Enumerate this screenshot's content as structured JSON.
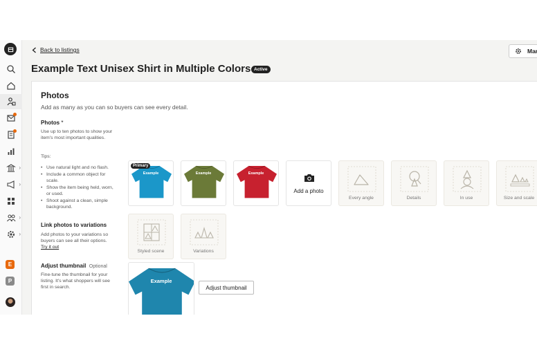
{
  "nav": {
    "back_label": "Back to listings",
    "manage_label": "Mar"
  },
  "listing": {
    "title": "Example Text Unisex Shirt in Multiple Colors",
    "status": "Active"
  },
  "rail": {
    "shop_badges": [
      {
        "letter": "E",
        "color": "#e8690d"
      },
      {
        "letter": "P",
        "color": "#8a8a8a"
      }
    ]
  },
  "photos": {
    "section_title": "Photos",
    "section_subtitle": "Add as many as you can so buyers can see every detail.",
    "side_heading": "Photos",
    "required_mark": "*",
    "side_text": "Use up to ten photos to show your item's most important qualities.",
    "tips_label": "Tips:",
    "tips": [
      "Use natural light and no flash.",
      "Include a common object for scale.",
      "Show the item being held, worn, or used.",
      "Shoot against a clean, simple background."
    ],
    "uploaded": [
      {
        "label": "Example",
        "color": "#1b97c9",
        "primary": true
      },
      {
        "label": "Example",
        "color": "#6b7a38",
        "primary": false
      },
      {
        "label": "Example",
        "color": "#c7212f",
        "primary": false
      }
    ],
    "primary_label": "Primary",
    "add_label": "Add a photo",
    "placeholders": [
      "Every angle",
      "Details",
      "In use",
      "Size and scale",
      "Styled scene",
      "Variations"
    ]
  },
  "variations": {
    "heading": "Link photos to variations",
    "text": "Add photos to your variations so buyers can see all their options.",
    "link": "Try it out"
  },
  "thumbnail": {
    "heading": "Adjust thumbnail",
    "optional": "Optional",
    "text": "Fine-tune the thumbnail for your listing. It's what shoppers will see first in search.",
    "shirt_label": "Example",
    "shirt_color": "#1f86ad",
    "button_label": "Adjust thumbnail"
  }
}
